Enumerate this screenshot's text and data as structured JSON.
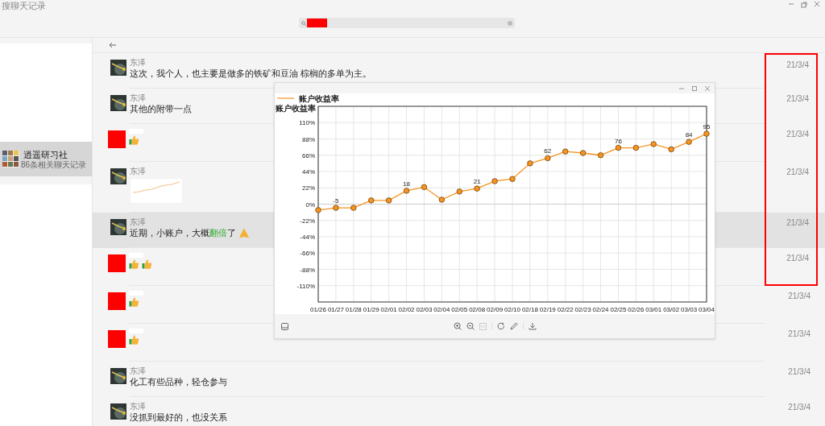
{
  "window": {
    "title": "搜聊天记录"
  },
  "sidebar": {
    "items": [
      {
        "name": "逍遥研习社",
        "subtitle": "86条相关聊天记录",
        "selected": true
      }
    ]
  },
  "messages": [
    {
      "avatar": {
        "kind": "photo"
      },
      "sender": "东泽",
      "kind": "text",
      "segments": [
        {
          "text": "这次，我个人，也主要是做多的铁矿和豆油 棕榈的多单为主。",
          "highlight": false
        }
      ],
      "date": "21/3/4",
      "highlighted": false,
      "marked": true
    },
    {
      "avatar": {
        "kind": "photo"
      },
      "sender": "东泽",
      "kind": "text",
      "segments": [
        {
          "text": "其他的附带一点",
          "highlight": false
        }
      ],
      "date": "21/3/4",
      "highlighted": false,
      "marked": true
    },
    {
      "avatar": {
        "kind": "redacted"
      },
      "kind": "emoji",
      "emojis": [
        {
          "kind": "thumbs-up"
        }
      ],
      "date": "21/3/4",
      "highlighted": false,
      "marked": true
    },
    {
      "avatar": {
        "kind": "photo"
      },
      "sender": "东泽",
      "kind": "image",
      "date": "21/3/4",
      "highlighted": false,
      "marked": true
    },
    {
      "avatar": {
        "kind": "photo"
      },
      "sender": "东泽",
      "kind": "text",
      "segments": [
        {
          "text": "近期，小账户，大概",
          "highlight": false
        },
        {
          "text": "翻倍",
          "highlight": true
        },
        {
          "text": "了",
          "highlight": false
        }
      ],
      "emojis": [
        {
          "kind": "praying-hands"
        }
      ],
      "date": "21/3/4",
      "highlighted": true,
      "marked": true
    },
    {
      "avatar": {
        "kind": "redacted"
      },
      "kind": "emoji",
      "emojis": [
        {
          "kind": "thumbs-up"
        },
        {
          "kind": "thumbs-up"
        }
      ],
      "date": "21/3/4",
      "highlighted": false,
      "marked": true
    },
    {
      "avatar": {
        "kind": "redacted"
      },
      "kind": "emoji",
      "emojis": [
        {
          "kind": "thumbs-up"
        }
      ],
      "date": "21/3/4",
      "highlighted": false,
      "marked": false
    },
    {
      "avatar": {
        "kind": "redacted"
      },
      "kind": "emoji",
      "emojis": [
        {
          "kind": "thumbs-up"
        }
      ],
      "date": "21/3/4",
      "highlighted": false,
      "marked": false
    },
    {
      "avatar": {
        "kind": "photo"
      },
      "sender": "东泽",
      "kind": "text",
      "segments": [
        {
          "text": "化工有些品种，轻仓参与",
          "highlight": false
        }
      ],
      "date": "21/3/4",
      "highlighted": false,
      "marked": false
    },
    {
      "avatar": {
        "kind": "photo"
      },
      "sender": "东泽",
      "kind": "text",
      "segments": [
        {
          "text": "没抓到最好的，也没关系",
          "highlight": false
        }
      ],
      "date": "21/3/4",
      "highlighted": false,
      "marked": false
    }
  ],
  "chart_window": {
    "chart_data": {
      "type": "line",
      "ylabel": "账户收益率",
      "grid": true,
      "categories": [
        "01/26",
        "01/27",
        "01/28",
        "01/29",
        "02/01",
        "02/02",
        "02/03",
        "02/04",
        "02/05",
        "02/08",
        "02/09",
        "02/10",
        "02/18",
        "02/19",
        "02/22",
        "02/23",
        "02/24",
        "02/25",
        "02/26",
        "03/01",
        "03/02",
        "03/03",
        "03/04"
      ],
      "series": [
        {
          "name": "账户收益率",
          "color": "#f7931e",
          "marker": "circle",
          "values": [
            -8,
            -5,
            -5,
            5,
            5,
            18,
            23,
            6,
            17,
            21,
            31,
            34,
            55,
            62,
            71,
            69,
            66,
            76,
            76,
            81,
            74,
            84,
            95
          ]
        }
      ],
      "ylim": [
        -132,
        132
      ],
      "yticks": [
        {
          "value": 110,
          "label": "110%"
        },
        {
          "value": 88,
          "label": "88%"
        },
        {
          "value": 66,
          "label": "66%"
        },
        {
          "value": 44,
          "label": "44%"
        },
        {
          "value": 22,
          "label": "22%"
        },
        {
          "value": 0,
          "label": "0%"
        },
        {
          "value": -22,
          "label": "-22%"
        },
        {
          "value": -44,
          "label": "-44%"
        },
        {
          "value": -66,
          "label": "-66%"
        },
        {
          "value": -88,
          "label": "-88%"
        },
        {
          "value": -110,
          "label": "-110%"
        }
      ],
      "annotations": [
        {
          "x": "01/27",
          "y": -5,
          "text": "-5"
        },
        {
          "x": "02/02",
          "y": 18,
          "text": "18"
        },
        {
          "x": "02/08",
          "y": 21,
          "text": "21"
        },
        {
          "x": "02/19",
          "y": 62,
          "text": "62"
        },
        {
          "x": "02/25",
          "y": 76,
          "text": "76"
        },
        {
          "x": "03/03",
          "y": 84,
          "text": "84"
        },
        {
          "x": "03/04",
          "y": 95,
          "text": "95"
        }
      ]
    }
  }
}
